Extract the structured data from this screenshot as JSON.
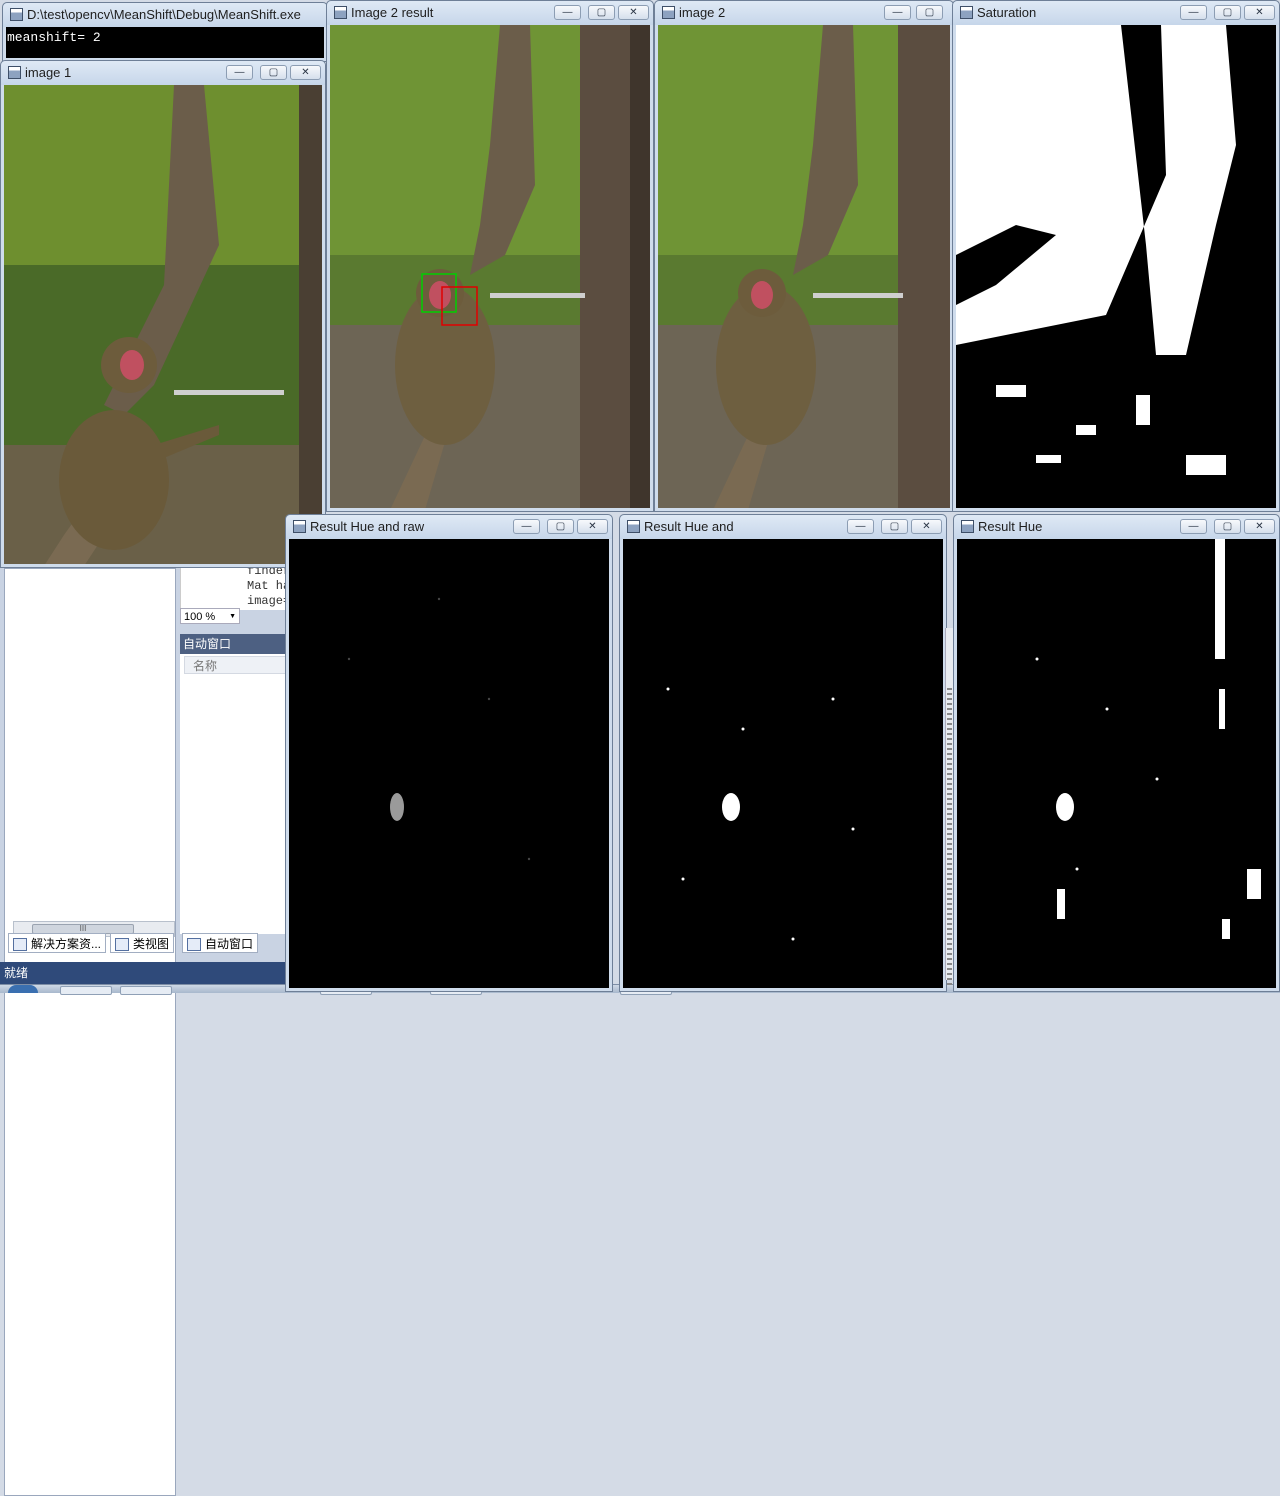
{
  "console": {
    "title": "D:\\test\\opencv\\MeanShift\\Debug\\MeanShift.exe",
    "output": "meanshift= 2"
  },
  "windows": {
    "image1": {
      "title": "image 1"
    },
    "image2_result": {
      "title": "Image 2 result"
    },
    "image2": {
      "title": "image 2"
    },
    "saturation": {
      "title": "Saturation"
    },
    "result_hue_raw": {
      "title": "Result Hue and raw"
    },
    "result_hue_and": {
      "title": "Result Hue and"
    },
    "result_hue": {
      "title": "Result Hue"
    }
  },
  "controls": {
    "minimize": "—",
    "maximize": "▢",
    "close": "✕"
  },
  "ide": {
    "code_lines": [
      "finder",
      "Mat ha",
      "image="
    ],
    "zoom_value": "100 %",
    "auto_window_title": "自动窗口",
    "name_column": "名称",
    "tabs": {
      "solution_explorer": "解决方案资...",
      "class_view": "类视图",
      "auto_window": "自动窗口"
    },
    "status": "就绪"
  },
  "colors": {
    "title_bar": "#cfdcec",
    "ide_status_bar": "#2f4a7a",
    "detect_green": "#00d000",
    "detect_red": "#e00000"
  },
  "icons": [
    "window-app-icon",
    "minimize-icon",
    "maximize-icon",
    "close-icon",
    "zoom-dropdown-arrow-icon",
    "solution-explorer-icon",
    "class-view-icon",
    "auto-window-icon"
  ]
}
